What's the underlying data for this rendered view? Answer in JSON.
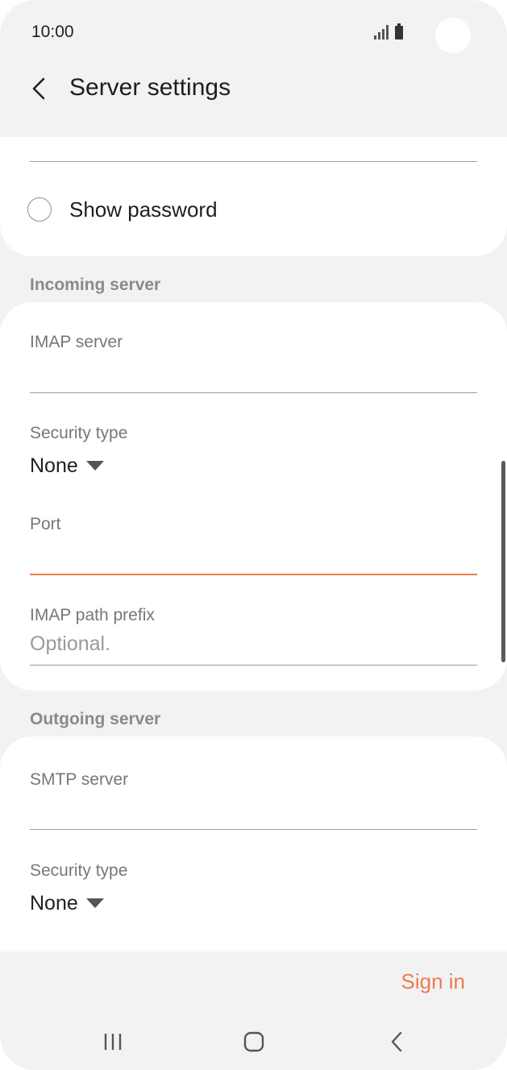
{
  "status_bar": {
    "time": "10:00"
  },
  "app_bar": {
    "title": "Server settings"
  },
  "account": {
    "show_password_label": "Show password",
    "show_password_checked": false
  },
  "incoming": {
    "section_title": "Incoming server",
    "server_label": "IMAP server",
    "server_value": "",
    "security_label": "Security type",
    "security_value": "None",
    "port_label": "Port",
    "port_value": "",
    "path_prefix_label": "IMAP path prefix",
    "path_prefix_placeholder": "Optional."
  },
  "outgoing": {
    "section_title": "Outgoing server",
    "server_label": "SMTP server",
    "server_value": "",
    "security_label": "Security type",
    "security_value": "None"
  },
  "actions": {
    "sign_in_label": "Sign in"
  },
  "colors": {
    "accent": "#f07a4c",
    "background": "#f2f2f2",
    "card": "#ffffff"
  }
}
